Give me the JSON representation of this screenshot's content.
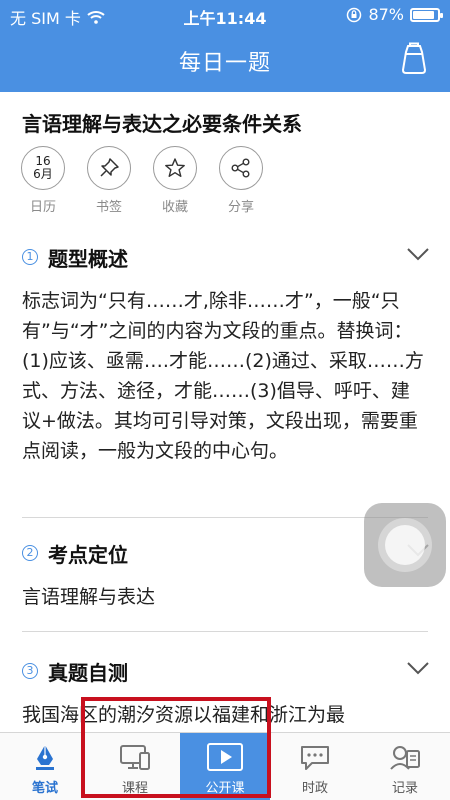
{
  "status_bar": {
    "carrier": "无 SIM 卡",
    "time": "上午11:44",
    "battery": "87%",
    "battery_level": 0.87
  },
  "header": {
    "title": "每日一题",
    "right_icon": "cup-icon"
  },
  "question": {
    "title": "言语理解与表达之必要条件关系"
  },
  "actions": [
    {
      "label": "日历",
      "icon": "calendar-icon",
      "day": "16",
      "month": "6月"
    },
    {
      "label": "书签",
      "icon": "pin-icon"
    },
    {
      "label": "收藏",
      "icon": "star-icon"
    },
    {
      "label": "分享",
      "icon": "share-icon"
    }
  ],
  "sections": [
    {
      "num": "1",
      "title": "题型概述",
      "body": "标志词为“只有……才,除非……才”，一般“只有”与“才”之间的内容为文段的重点。替换词：(1)应该、亟需….才能……(2)通过、采取……方式、方法、途径，才能……(3)倡导、呼吁、建议+做法。其均可引导对策，文段出现，需要重点阅读，一般为文段的中心句。"
    },
    {
      "num": "2",
      "title": "考点定位",
      "body": "言语理解与表达"
    },
    {
      "num": "3",
      "title": "真题自测",
      "body": "我国海区的潮汐资源以福建和浙江为最"
    }
  ],
  "tabs": [
    {
      "label": "笔试",
      "icon": "pen-nib-icon"
    },
    {
      "label": "课程",
      "icon": "monitor-icon"
    },
    {
      "label": "公开课",
      "icon": "play-icon"
    },
    {
      "label": "时政",
      "icon": "chat-icon"
    },
    {
      "label": "记录",
      "icon": "records-icon"
    }
  ],
  "colors": {
    "primary": "#4a90e2",
    "highlight_box": "#c8101e"
  }
}
